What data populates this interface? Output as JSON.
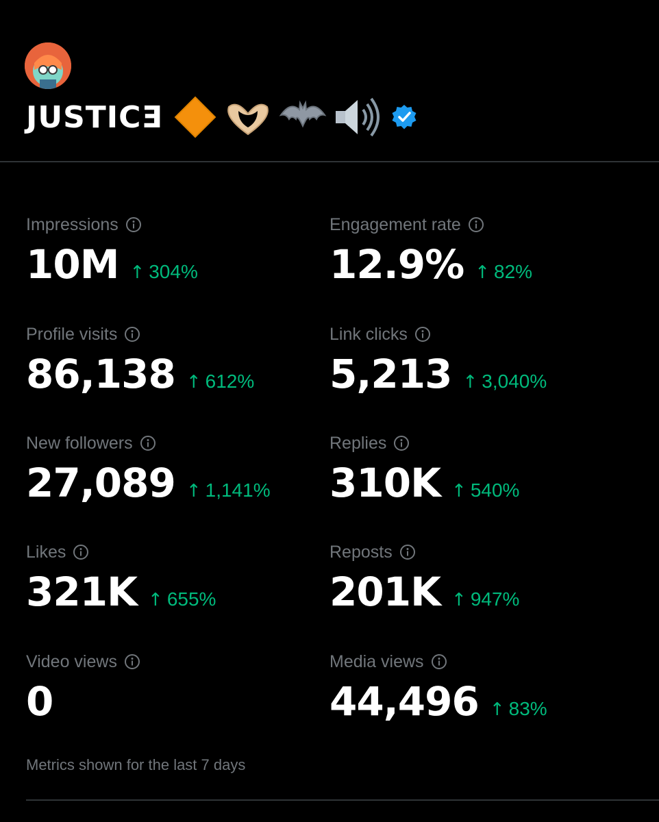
{
  "profile": {
    "display_name": "JUSTICƎ",
    "emoji": [
      "orange-diamond",
      "heart-hands",
      "bat",
      "speaker-high-volume"
    ],
    "verified": true
  },
  "metrics": [
    {
      "label": "Impressions",
      "value": "10M",
      "change": "304%",
      "direction": "up"
    },
    {
      "label": "Engagement rate",
      "value": "12.9%",
      "change": "82%",
      "direction": "up"
    },
    {
      "label": "Profile visits",
      "value": "86,138",
      "change": "612%",
      "direction": "up"
    },
    {
      "label": "Link clicks",
      "value": "5,213",
      "change": "3,040%",
      "direction": "up"
    },
    {
      "label": "New followers",
      "value": "27,089",
      "change": "1,141%",
      "direction": "up"
    },
    {
      "label": "Replies",
      "value": "310K",
      "change": "540%",
      "direction": "up"
    },
    {
      "label": "Likes",
      "value": "321K",
      "change": "655%",
      "direction": "up"
    },
    {
      "label": "Reposts",
      "value": "201K",
      "change": "947%",
      "direction": "up"
    },
    {
      "label": "Video views",
      "value": "0",
      "change": "",
      "direction": ""
    },
    {
      "label": "Media views",
      "value": "44,496",
      "change": "83%",
      "direction": "up"
    }
  ],
  "footer": {
    "note": "Metrics shown for the last 7 days"
  },
  "colors": {
    "background": "#000000",
    "label": "#71767b",
    "value": "#ffffff",
    "positive": "#00ba7c",
    "verified": "#1d9bf0",
    "divider": "#2f3336"
  }
}
